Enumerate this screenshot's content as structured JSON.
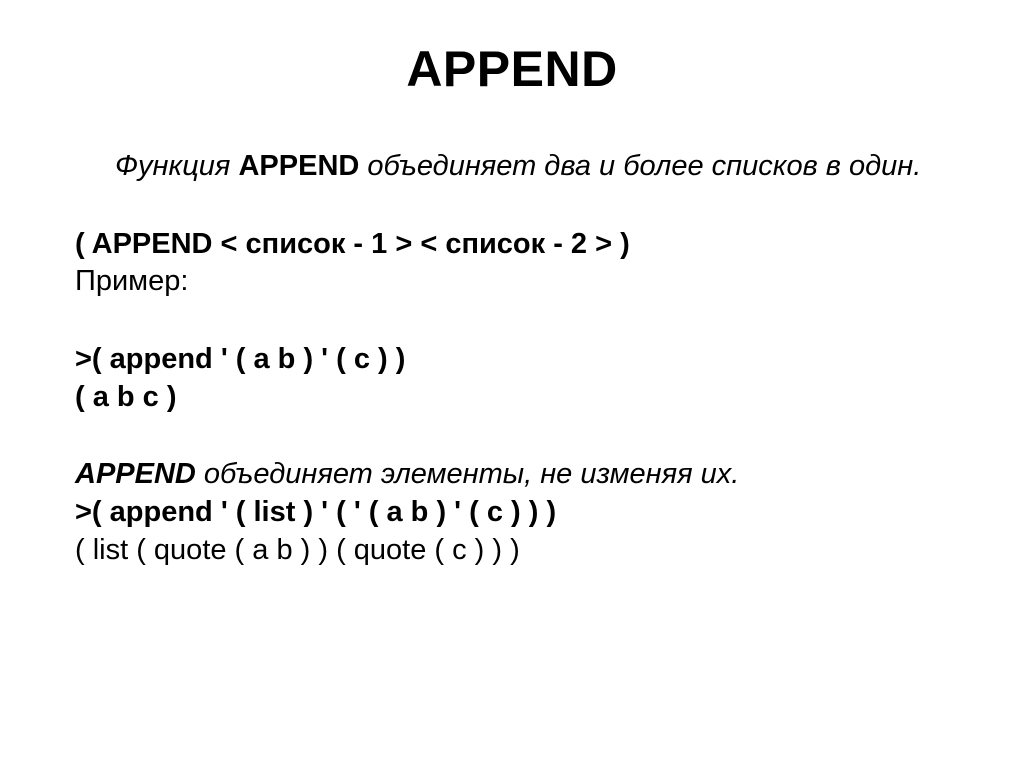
{
  "title": "APPEND",
  "intro": {
    "prefix": "Функция ",
    "bold": "APPEND",
    "suffix": " объединяет два и более списков в один."
  },
  "syntax": "( APPEND < список - 1 > < список - 2 > )",
  "example_label": "Пример:",
  "example1_in": ">( append ' ( a b ) ' ( c ) )",
  "example1_out": "( a b c )",
  "note": {
    "bold": "APPEND",
    "rest": " объединяет элементы, не изменяя их."
  },
  "example2_in": ">( append ' ( list ) ' ( ' ( a b ) ' ( c ) ) )",
  "example2_out": "( list ( quote ( a b ) ) ( quote ( c ) ) )"
}
